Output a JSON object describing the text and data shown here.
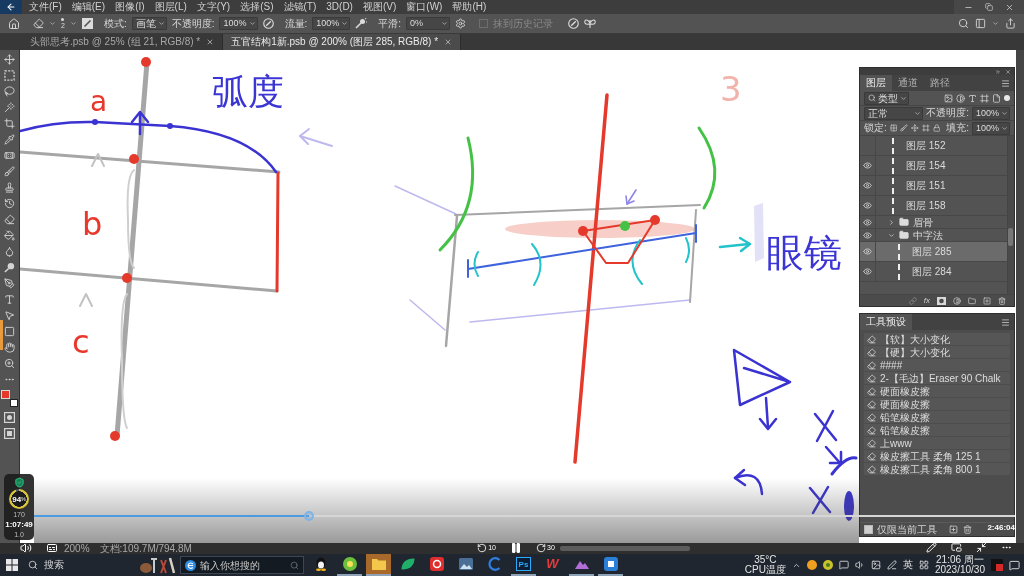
{
  "menu_bar": {
    "items": [
      "文件(F)",
      "编辑(E)",
      "图像(I)",
      "图层(L)",
      "文字(Y)",
      "选择(S)",
      "滤镜(T)",
      "3D(D)",
      "视图(V)",
      "窗口(W)",
      "帮助(H)"
    ]
  },
  "options_bar": {
    "brush_size": "2",
    "mode_label": "模式:",
    "mode": "画笔",
    "opacity_label": "不透明度:",
    "opacity": "100%",
    "flow_label": "流量:",
    "flow": "100%",
    "smoothing_label": "平滑:",
    "smoothing": "0%",
    "history_option": {
      "label": "抹到历史记录",
      "checked": false,
      "disabled": true
    }
  },
  "document_tabs": [
    {
      "title": "头部思考.psb @ 25% (组 21, RGB/8) *",
      "selected": false
    },
    {
      "title": "五官结构1新.psb @ 200% (图层 285, RGB/8) *",
      "selected": true
    }
  ],
  "toolbar": {
    "swatches": [
      {
        "color": "#e8382c"
      },
      {
        "color": "#ffffff"
      }
    ]
  },
  "canvas": {
    "annotations": [
      {
        "text": "3",
        "color": "#f2b3aa"
      },
      {
        "text": "a",
        "color": "#e8382c"
      },
      {
        "text": "弧度",
        "color": "#3b35d4"
      },
      {
        "text": "b",
        "color": "#e8382c"
      },
      {
        "text": "c",
        "color": "#e8382c"
      },
      {
        "text": "眼镜",
        "color": "#3b35d4"
      }
    ]
  },
  "layers_panel": {
    "tabs": [
      {
        "label": "图层",
        "selected": true
      },
      {
        "label": "通道",
        "selected": false
      },
      {
        "label": "路径",
        "selected": false
      }
    ],
    "filter": "类型",
    "blend_mode": "正常",
    "opacity_label": "不透明度:",
    "opacity": "100%",
    "lock_label": "锁定:",
    "fill_label": "填充:",
    "fill": "100%",
    "fx": "fx",
    "layers": [
      {
        "name": "图层 152",
        "kind": "layer",
        "visible": false,
        "selected": false
      },
      {
        "name": "图层 154",
        "kind": "layer",
        "visible": true,
        "selected": false
      },
      {
        "name": "图层 151",
        "kind": "layer",
        "visible": true,
        "selected": false
      },
      {
        "name": "图层 158",
        "kind": "layer",
        "visible": true,
        "selected": false
      },
      {
        "name": "眉骨",
        "kind": "group",
        "visible": true,
        "expanded": false,
        "selected": false
      },
      {
        "name": "中字法",
        "kind": "group",
        "visible": true,
        "expanded": true,
        "selected": false,
        "children": [
          {
            "name": "图层 285",
            "kind": "layer",
            "visible": true,
            "selected": true
          },
          {
            "name": "图层 284",
            "kind": "layer",
            "visible": true,
            "selected": false
          }
        ]
      }
    ]
  },
  "tool_presets_panel": {
    "title": "工具预设",
    "presets": [
      "【软】大小变化",
      "【硬】大小变化",
      "####",
      "2-【毛边】Eraser 90 Chalk",
      "硬面橡皮擦",
      "硬面橡皮擦",
      "铅笔橡皮擦",
      "铅笔橡皮擦",
      "上www",
      "橡皮擦工具 柔角 125 1",
      "橡皮擦工具 柔角 800 1"
    ],
    "current_tool_only": {
      "label": "仅限当前工具",
      "checked": true
    }
  },
  "status_bar": {
    "zoom": "200%",
    "document": "文档:109.7M/794.8M"
  },
  "monitor_widget": {
    "gauge": {
      "value": "94",
      "unit": "%"
    },
    "reading_1": "170",
    "reading_2": "1.0"
  },
  "video_player": {
    "current_time": "1:07:49",
    "level": 0.28,
    "duration": "2:46:04",
    "playing": true,
    "rewind_seconds": "10",
    "forward_seconds": "30"
  },
  "taskbar": {
    "search_label": "搜索",
    "search_placeholder": "输入你想搜的",
    "apps": [
      {
        "kind": "penguin",
        "running": false,
        "selected": false
      },
      {
        "kind": "globe",
        "running": true,
        "selected": false
      },
      {
        "kind": "folder",
        "running": true,
        "selected": true
      },
      {
        "kind": "leaf",
        "running": false,
        "selected": false
      },
      {
        "kind": "swirl",
        "running": false,
        "selected": false
      },
      {
        "kind": "picture",
        "running": false,
        "selected": false
      },
      {
        "kind": "ring",
        "running": false,
        "selected": false
      },
      {
        "kind": "logo",
        "label": "Ps",
        "running": true,
        "selected": false
      },
      {
        "kind": "wordmark",
        "label": "W",
        "running": false,
        "selected": false
      },
      {
        "kind": "mountain",
        "running": true,
        "selected": false
      },
      {
        "kind": "tile",
        "running": true,
        "selected": false
      }
    ],
    "temperature": "35°C",
    "temperature_label": "CPU温度",
    "input_method": "英",
    "time": "21:06 周一",
    "date": "2023/10/30"
  }
}
